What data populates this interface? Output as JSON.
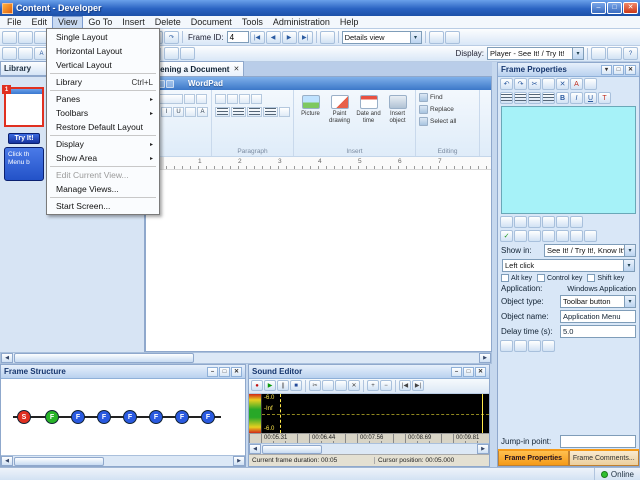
{
  "window": {
    "title": "Content - Developer"
  },
  "icons": {
    "minimize": "–",
    "maximize": "□",
    "close": "✕",
    "dropdown": "▾",
    "submenu": "▸",
    "check": "✓",
    "nav_first": "|◀",
    "nav_prev": "◀",
    "nav_next": "▶",
    "nav_last": "▶|",
    "scroll_left": "◀",
    "scroll_right": "▶",
    "play": "▶",
    "record": "●",
    "stop": "■",
    "pause": "||",
    "cut": "✂",
    "undo": "↶",
    "redo": "↷",
    "bold": "B",
    "italic": "I",
    "underline": "U",
    "font_a": "A",
    "color_t": "T",
    "zoom_in": "+",
    "zoom_out": "−",
    "help": "?"
  },
  "menu_bar": {
    "items": [
      "File",
      "Edit",
      "View",
      "Go To",
      "Insert",
      "Delete",
      "Document",
      "Tools",
      "Administration",
      "Help"
    ],
    "open_item": "View"
  },
  "view_menu": {
    "items": [
      {
        "label": "Single Layout"
      },
      {
        "label": "Horizontal Layout"
      },
      {
        "label": "Vertical Layout"
      },
      {
        "label": "Library",
        "shortcut": "Ctrl+L"
      },
      {
        "label": "Panes",
        "has_submenu": true
      },
      {
        "label": "Toolbars",
        "has_submenu": true
      },
      {
        "label": "Restore Default Layout"
      },
      {
        "label": "Display",
        "has_submenu": true
      },
      {
        "label": "Show Area",
        "has_submenu": true
      },
      {
        "label": "Edit Current View...",
        "disabled": true
      },
      {
        "label": "Manage Views..."
      },
      {
        "label": "Start Screen..."
      }
    ]
  },
  "toolbar_main": {
    "frame_id_label": "Frame ID:",
    "frame_id_value": "4",
    "details_view_value": "Details view"
  },
  "toolbar_second": {
    "display_label": "Display:",
    "display_value": "Player - See It! / Try It!"
  },
  "library_panel": {
    "button_label": "Library",
    "frame_badge": "1",
    "try_it_label": "Try It!",
    "caption_line1": "Click th",
    "caption_line2": "Menu b"
  },
  "document_tabs": {
    "active_tab": "Opening a Document"
  },
  "wordpad": {
    "title": "WordPad",
    "groups": {
      "paragraph": "Paragraph",
      "insert": "Insert",
      "editing": "Editing"
    },
    "insert_buttons": [
      "Picture",
      "Paint drawing",
      "Date and time",
      "Insert object"
    ],
    "editing_buttons": [
      "Find",
      "Replace",
      "Select all"
    ],
    "ruler_numbers": [
      "1",
      "2",
      "3",
      "4",
      "5",
      "6",
      "7"
    ]
  },
  "frame_properties": {
    "title": "Frame Properties",
    "show_in_label": "Show in:",
    "show_in_value": "See It! / Try It!, Know It?, P",
    "mouse_action_value": "Left click",
    "checkboxes": [
      "Alt key",
      "Control key",
      "Shift key"
    ],
    "application_label": "Application:",
    "application_value": "Windows Application",
    "object_type_label": "Object type:",
    "object_type_value": "Toolbar button",
    "object_name_label": "Object name:",
    "object_name_value": "Application Menu",
    "delay_label": "Delay time (s):",
    "delay_value": "5.0",
    "jump_in_label": "Jump-in point:",
    "tabs": [
      "Frame Properties",
      "Frame Comments..."
    ]
  },
  "frame_structure": {
    "title": "Frame Structure",
    "nodes": [
      {
        "label": "S",
        "color": "#e03020"
      },
      {
        "label": "F",
        "color": "#28b428"
      },
      {
        "label": "F",
        "color": "#2a5ae0"
      },
      {
        "label": "F",
        "color": "#2a5ae0"
      },
      {
        "label": "F",
        "color": "#2a5ae0"
      },
      {
        "label": "F",
        "color": "#2a5ae0"
      },
      {
        "label": "F",
        "color": "#2a5ae0"
      },
      {
        "label": "F",
        "color": "#2a5ae0"
      }
    ]
  },
  "sound_editor": {
    "title": "Sound Editor",
    "scale_labels": [
      "-6.0",
      "-Inf",
      "-6.0"
    ],
    "timeline_labels": [
      "00:05.31",
      "00:06.44",
      "00:07.56",
      "00:08.69",
      "00:09.81"
    ],
    "status_duration": "Current frame duration: 00:05",
    "status_cursor": "Cursor position: 00:05.000"
  },
  "status_bar": {
    "online_label": "Online"
  },
  "colors": {
    "titlebar_blue": "#2a63c2",
    "accent_orange": "#f59a18",
    "caption_cyan": "#a6f2f8",
    "node_start_red": "#e03020",
    "node_first_green": "#28b428",
    "node_frame_blue": "#2a5ae0",
    "online_green": "#2fbf2f"
  }
}
